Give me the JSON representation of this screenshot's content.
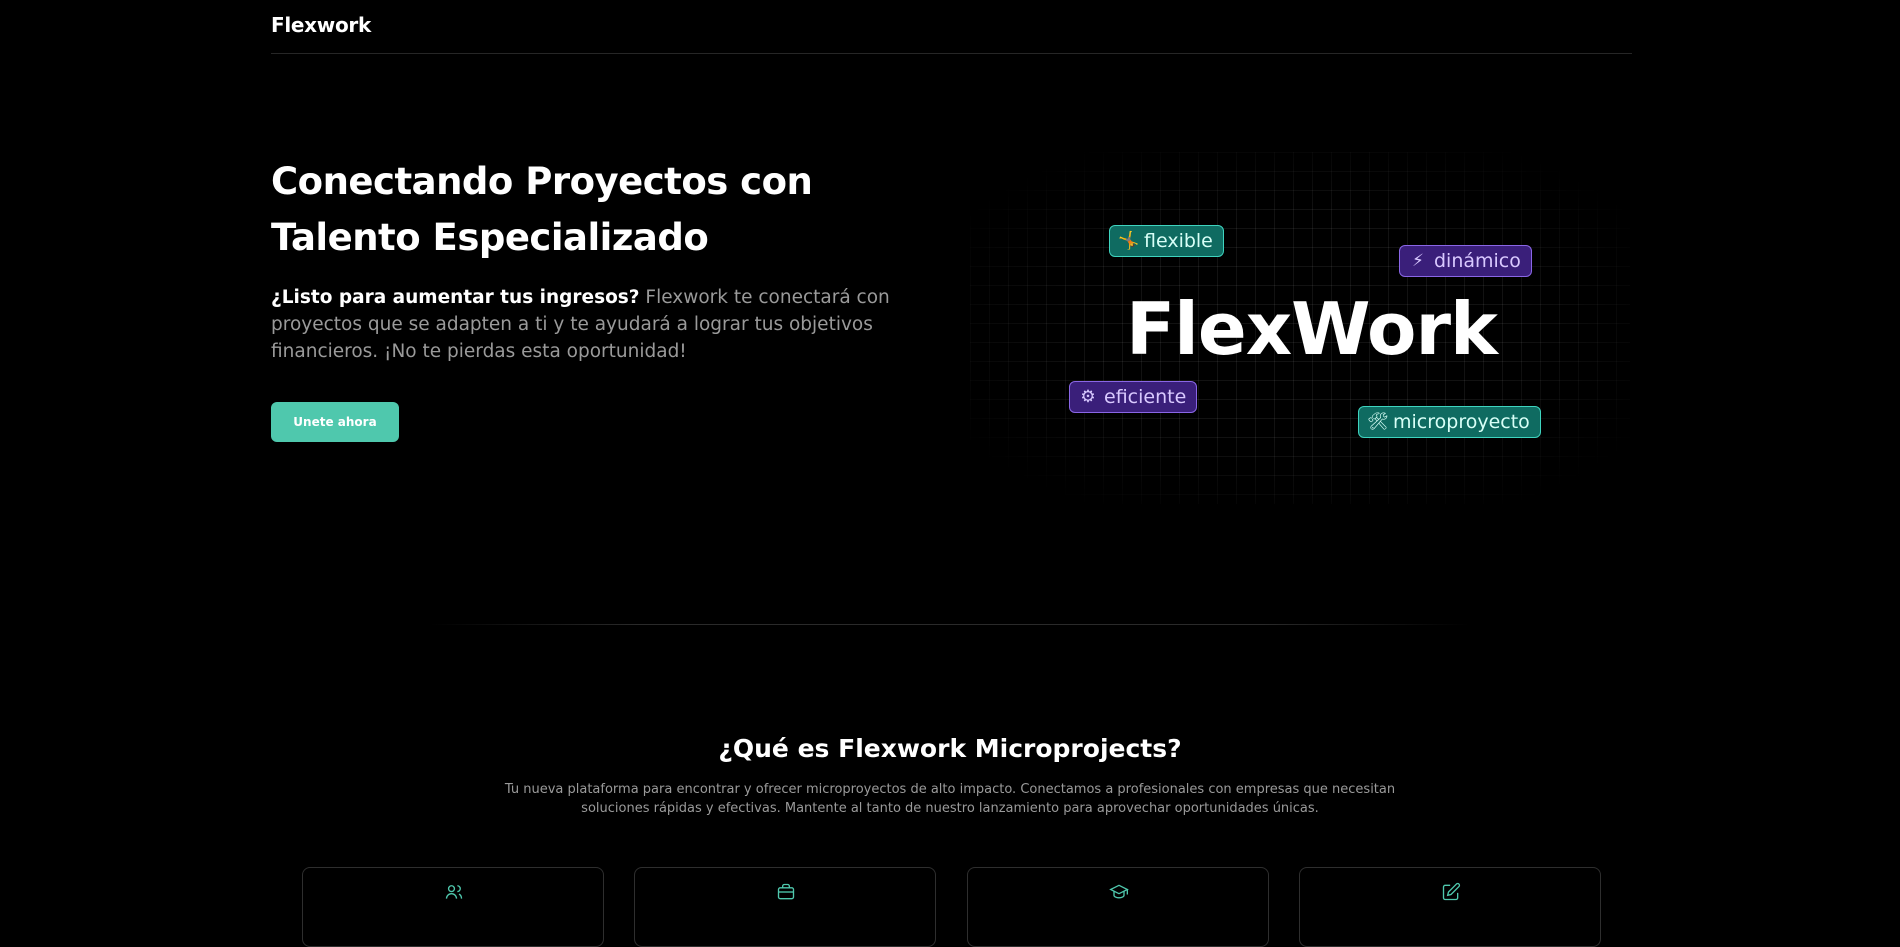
{
  "nav": {
    "brand": "Flexwork"
  },
  "hero": {
    "title": "Conectando Proyectos con Talento Especializado",
    "lead_bold": "¿Listo para aumentar tus ingresos?",
    "lead_text": " Flexwork te conectará con proyectos que se adapten a ti y te ayudará a lograr tus objetivos financieros. ¡No te pierdas esta oportunidad!",
    "cta_label": "Unete ahora",
    "visual": {
      "word": "FlexWork",
      "tags": [
        {
          "label": "flexible",
          "icon": "🤸",
          "icon_name": "acrobat-icon",
          "style": "teal"
        },
        {
          "label": "dinámico",
          "icon": "⚡",
          "icon_name": "lightning-icon",
          "style": "purple"
        },
        {
          "label": "eficiente",
          "icon": "⚙",
          "icon_name": "gear-icon",
          "style": "purple"
        },
        {
          "label": "microproyecto",
          "icon": "🛠",
          "icon_name": "tools-icon",
          "style": "teal"
        }
      ]
    }
  },
  "about": {
    "title": "¿Qué es Flexwork Microprojects?",
    "text": "Tu nueva plataforma para encontrar y ofrecer microproyectos de alto impacto. Conectamos a profesionales con empresas que necesitan soluciones rápidas y efectivas. Mantente al tanto de nuestro lanzamiento para aprovechar oportunidades únicas.",
    "cards": [
      {
        "icon": "users-icon"
      },
      {
        "icon": "briefcase-icon"
      },
      {
        "icon": "graduation-cap-icon"
      },
      {
        "icon": "edit-icon"
      }
    ]
  },
  "colors": {
    "background": "#000000",
    "accent": "#4fc8ad",
    "tag_teal": "#0f6b61",
    "tag_purple": "#3a1f7a",
    "muted_text": "#9a9a9a"
  }
}
